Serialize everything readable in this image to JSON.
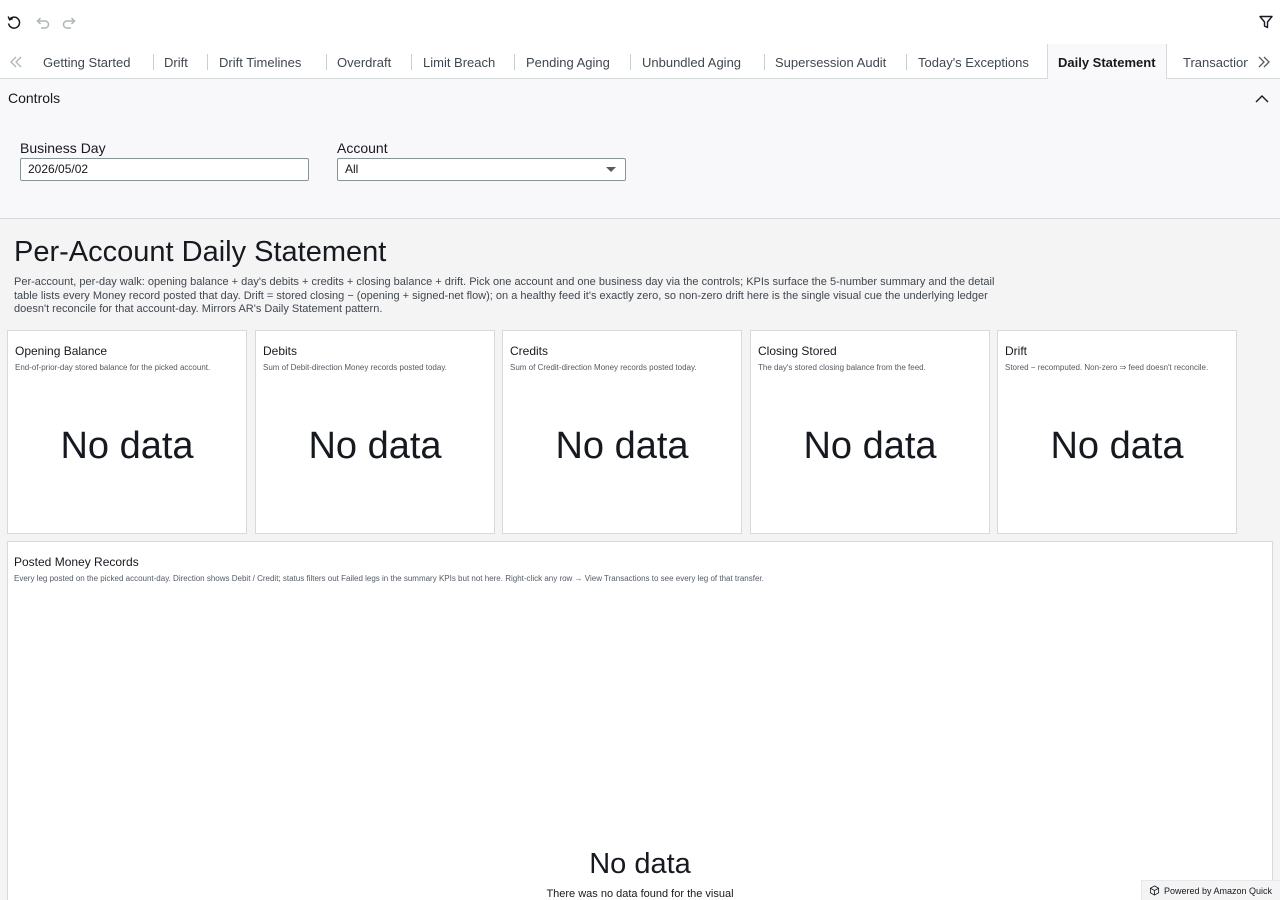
{
  "toolbar": {
    "reset_icon": "reset-icon",
    "undo_icon": "undo-icon",
    "redo_icon": "redo-icon",
    "filter_icon": "filter-icon"
  },
  "tabs": [
    {
      "label": "Getting Started"
    },
    {
      "label": "Drift"
    },
    {
      "label": "Drift Timelines"
    },
    {
      "label": "Overdraft"
    },
    {
      "label": "Limit Breach"
    },
    {
      "label": "Pending Aging"
    },
    {
      "label": "Unbundled Aging"
    },
    {
      "label": "Supersession Audit"
    },
    {
      "label": "Today's Exceptions"
    },
    {
      "label": "Daily Statement",
      "active": true
    },
    {
      "label": "Transactions"
    }
  ],
  "controls": {
    "title": "Controls",
    "business_day": {
      "label": "Business Day",
      "value": "2026/05/02"
    },
    "account": {
      "label": "Account",
      "value": "All"
    }
  },
  "sheet": {
    "title": "Per-Account Daily Statement",
    "description": "Per-account, per-day walk: opening balance + day's debits + credits + closing balance + drift. Pick one account and one business day via the controls; KPIs surface the 5-number summary and the detail table lists every Money record posted that day. Drift = stored closing − (opening + signed-net flow); on a healthy feed it's exactly zero, so non-zero drift here is the single visual cue the underlying ledger doesn't reconcile for that account-day. Mirrors AR's Daily Statement pattern."
  },
  "kpis": [
    {
      "title": "Opening Balance",
      "subtitle": "End-of-prior-day stored balance for the picked account.",
      "value": "No data"
    },
    {
      "title": "Debits",
      "subtitle": "Sum of Debit-direction Money records posted today.",
      "value": "No data"
    },
    {
      "title": "Credits",
      "subtitle": "Sum of Credit-direction Money records posted today.",
      "value": "No data"
    },
    {
      "title": "Closing Stored",
      "subtitle": "The day's stored closing balance from the feed.",
      "value": "No data"
    },
    {
      "title": "Drift",
      "subtitle": "Stored − recomputed. Non-zero ⇒ feed doesn't reconcile.",
      "value": "No data"
    }
  ],
  "table": {
    "title": "Posted Money Records",
    "subtitle": "Every leg posted on the picked account-day. Direction shows Debit / Credit; status filters out Failed legs in the summary KPIs but not here. Right-click any row → View Transactions to see every leg of that transfer.",
    "empty_title": "No data",
    "empty_message": "There was no data found for the visual"
  },
  "footer": {
    "powered_by": "Powered by Amazon Quick"
  }
}
